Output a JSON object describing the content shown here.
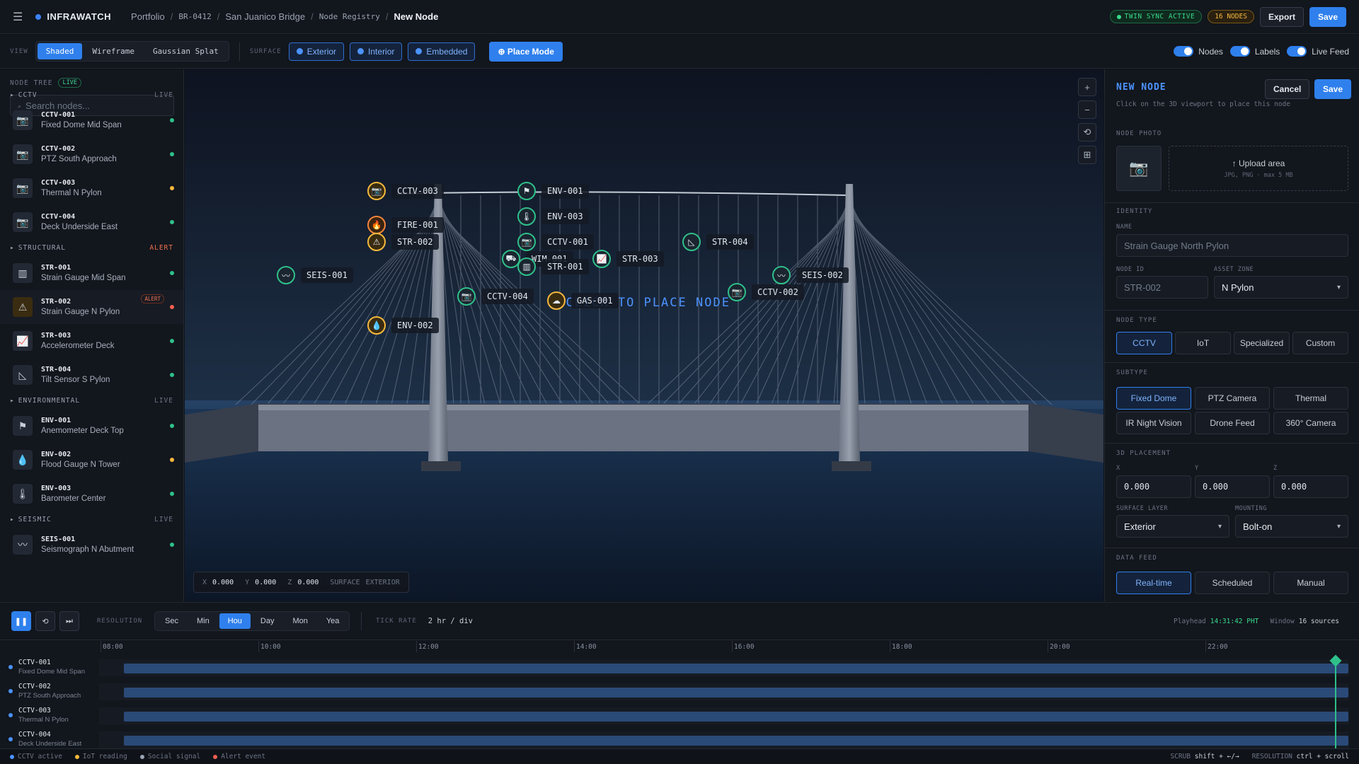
{
  "app": {
    "brand": "INFRAWATCH",
    "menu_icon": "hamburger-icon"
  },
  "breadcrumb": {
    "portfolio": "Portfolio",
    "asset_id": "BR-0412",
    "asset_name": "San Juanico Bridge",
    "registry": "Node Registry",
    "current": "New Node"
  },
  "header": {
    "sync_status": "TWIN SYNC ACTIVE",
    "node_count": "16 NODES",
    "export_label": "Export",
    "save_label": "Save"
  },
  "toolbar": {
    "view_label": "VIEW",
    "view_modes": [
      "Shaded",
      "Wireframe",
      "Gaussian Splat"
    ],
    "active_view": "Shaded",
    "surface_label": "SURFACE",
    "surfaces": [
      "Exterior",
      "Interior",
      "Embedded"
    ],
    "place_mode_label": "Place Mode",
    "toggles": [
      "Nodes",
      "Labels",
      "Live Feed"
    ]
  },
  "sidebar": {
    "title": "NODE TREE",
    "live_badge": "LIVE",
    "search_placeholder": "Search nodes...",
    "groups": [
      {
        "name": "CCTV",
        "status": "LIVE",
        "nodes": [
          {
            "id": "CCTV-001",
            "name": "Fixed Dome Mid Span",
            "icon": "camera-icon",
            "status_color": "#2fc08a"
          },
          {
            "id": "CCTV-002",
            "name": "PTZ South Approach",
            "icon": "camera-icon",
            "status_color": "#2fc08a"
          },
          {
            "id": "CCTV-003",
            "name": "Thermal N Pylon",
            "icon": "camera-icon",
            "status_color": "#f5b93d"
          },
          {
            "id": "CCTV-004",
            "name": "Deck Underside East",
            "icon": "camera-icon",
            "status_color": "#2fc08a"
          }
        ]
      },
      {
        "name": "STRUCTURAL",
        "status": "ALERT",
        "nodes": [
          {
            "id": "STR-001",
            "name": "Strain Gauge Mid Span",
            "icon": "bar-chart-icon",
            "status_color": "#2fc08a"
          },
          {
            "id": "STR-002",
            "name": "Strain Gauge N Pylon",
            "icon": "warning-icon",
            "status_color": "#f06050",
            "badge": "ALERT"
          },
          {
            "id": "STR-003",
            "name": "Accelerometer Deck",
            "icon": "line-chart-icon",
            "status_color": "#2fc08a"
          },
          {
            "id": "STR-004",
            "name": "Tilt Sensor S Pylon",
            "icon": "tilt-icon",
            "status_color": "#2fc08a"
          }
        ]
      },
      {
        "name": "ENVIRONMENTAL",
        "status": "LIVE",
        "nodes": [
          {
            "id": "ENV-001",
            "name": "Anemometer Deck Top",
            "icon": "wind-icon",
            "status_color": "#2fc08a"
          },
          {
            "id": "ENV-002",
            "name": "Flood Gauge N Tower",
            "icon": "droplet-icon",
            "status_color": "#f5b93d"
          },
          {
            "id": "ENV-003",
            "name": "Barometer Center",
            "icon": "thermometer-icon",
            "status_color": "#2fc08a"
          }
        ]
      },
      {
        "name": "SEISMIC",
        "status": "LIVE",
        "nodes": [
          {
            "id": "SEIS-001",
            "name": "Seismograph N Abutment",
            "icon": "wave-icon",
            "status_color": "#2fc08a"
          }
        ]
      }
    ]
  },
  "viewport": {
    "place_hint": "⊕ CLICK TO PLACE NODE",
    "coords": {
      "x_label": "X",
      "x": "0.000",
      "y_label": "Y",
      "y": "0.000",
      "z_label": "Z",
      "z": "0.000",
      "surface_label": "SURFACE",
      "surface": "EXTERIOR"
    },
    "markers": [
      {
        "id": "CCTV-003",
        "glyph": "📷",
        "ring": "amber"
      },
      {
        "id": "FIRE-001",
        "glyph": "🔥",
        "ring": "orange"
      },
      {
        "id": "STR-002",
        "glyph": "⚠",
        "ring": "amber"
      },
      {
        "id": "SEIS-001",
        "glyph": "〰",
        "ring": "green"
      },
      {
        "id": "ENV-002",
        "glyph": "💧",
        "ring": "amber"
      },
      {
        "id": "ENV-001",
        "glyph": "⚑",
        "ring": "green"
      },
      {
        "id": "ENV-003",
        "glyph": "🌡",
        "ring": "green"
      },
      {
        "id": "CCTV-001",
        "glyph": "📷",
        "ring": "green"
      },
      {
        "id": "WIM-001",
        "glyph": "⛟",
        "ring": "green"
      },
      {
        "id": "STR-001",
        "glyph": "▥",
        "ring": "green"
      },
      {
        "id": "CCTV-004",
        "glyph": "📷",
        "ring": "green"
      },
      {
        "id": "GAS-001",
        "glyph": "☁",
        "ring": "amber"
      },
      {
        "id": "STR-003",
        "glyph": "📈",
        "ring": "green"
      },
      {
        "id": "STR-004",
        "glyph": "◺",
        "ring": "green"
      },
      {
        "id": "SEIS-002",
        "glyph": "〰",
        "ring": "green"
      },
      {
        "id": "CCTV-002",
        "glyph": "📷",
        "ring": "green"
      }
    ]
  },
  "panel": {
    "title": "NEW NODE",
    "subtitle": "Click on the 3D viewport to place this node",
    "cancel_label": "Cancel",
    "save_label": "Save",
    "photo_label": "NODE PHOTO",
    "upload_label": "↑ Upload area",
    "upload_hint": "JPG, PNG · max 5 MB",
    "identity_label": "IDENTITY",
    "name_label": "NAME",
    "name_placeholder": "Strain Gauge North Pylon",
    "node_id_label": "NODE ID",
    "node_id_placeholder": "STR-002",
    "zone_label": "ASSET ZONE",
    "zone_value": "N Pylon",
    "node_type_label": "NODE TYPE",
    "node_types": [
      "CCTV",
      "IoT",
      "Specialized",
      "Custom"
    ],
    "subtype_label": "SUBTYPE",
    "subtypes": [
      "Fixed Dome",
      "PTZ Camera",
      "Thermal",
      "IR Night Vision",
      "Drone Feed",
      "360° Camera"
    ],
    "placement_label": "3D PLACEMENT",
    "x_label": "X",
    "x": "0.000",
    "y_label": "Y",
    "y": "0.000",
    "z_label": "Z",
    "z": "0.000",
    "surface_layer_label": "SURFACE LAYER",
    "surface_layer_value": "Exterior",
    "mounting_label": "MOUNTING",
    "mounting_value": "Bolt-on",
    "data_feed_label": "DATA FEED",
    "data_feeds": [
      "Real-time",
      "Scheduled",
      "Manual"
    ]
  },
  "timeline": {
    "resolution_label": "RESOLUTION",
    "resolutions": [
      "Sec",
      "Min",
      "Hou",
      "Day",
      "Mon",
      "Yea"
    ],
    "tick_rate_label": "TICK RATE",
    "tick_rate": "2 hr / div",
    "playhead_label": "Playhead",
    "playhead_time": "14:31:42 PHT",
    "window_label": "Window",
    "window_value": "16 sources",
    "ticks": [
      "08:00",
      "10:00",
      "12:00",
      "14:00",
      "16:00",
      "18:00",
      "20:00",
      "22:00"
    ],
    "rows": [
      {
        "id": "CCTV-001",
        "name": "Fixed Dome Mid Span"
      },
      {
        "id": "CCTV-002",
        "name": "PTZ South Approach"
      },
      {
        "id": "CCTV-003",
        "name": "Thermal N Pylon"
      },
      {
        "id": "CCTV-004",
        "name": "Deck Underside East"
      }
    ]
  },
  "statusbar": {
    "legend": [
      {
        "label": "CCTV active",
        "color": "#4c93ff"
      },
      {
        "label": "IoT reading",
        "color": "#f5b93d"
      },
      {
        "label": "Social signal",
        "color": "#9aa3b2"
      },
      {
        "label": "Alert event",
        "color": "#f06050"
      }
    ],
    "scrub_label": "SCRUB",
    "scrub_keys": "shift + ←/→",
    "resolution_label": "RESOLUTION",
    "resolution_keys": "ctrl + scroll"
  }
}
